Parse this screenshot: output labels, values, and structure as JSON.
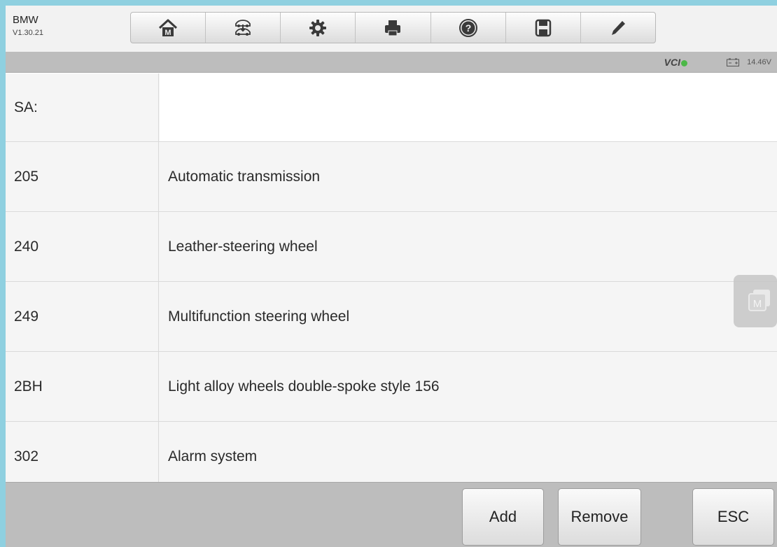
{
  "header": {
    "app_name": "BMW",
    "version": "V1.30.21",
    "toolbar": [
      {
        "icon": "home-icon"
      },
      {
        "icon": "vehicle-swap-icon"
      },
      {
        "icon": "settings-icon"
      },
      {
        "icon": "print-icon"
      },
      {
        "icon": "help-icon"
      },
      {
        "icon": "save-icon"
      },
      {
        "icon": "pen-icon"
      }
    ]
  },
  "status": {
    "vci_label": "VCI",
    "vci_connected_color": "#4cb848",
    "voltage": "14.46V"
  },
  "table": {
    "rows": [
      {
        "code": "SA:",
        "description": ""
      },
      {
        "code": "205",
        "description": "Automatic transmission"
      },
      {
        "code": "240",
        "description": "Leather-steering wheel"
      },
      {
        "code": "249",
        "description": "Multifunction steering wheel"
      },
      {
        "code": "2BH",
        "description": "Light alloy wheels double-spoke style 156"
      },
      {
        "code": "302",
        "description": "Alarm system"
      }
    ]
  },
  "footer": {
    "add_label": "Add",
    "remove_label": "Remove",
    "esc_label": "ESC"
  },
  "colors": {
    "background_frame": "#8fd0e0",
    "status_bar": "#bdbdbd"
  }
}
